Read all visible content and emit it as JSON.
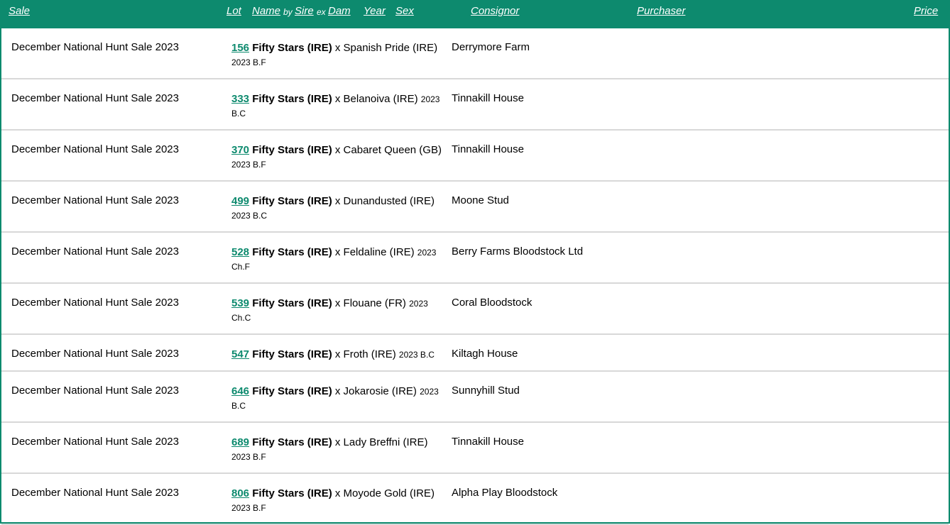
{
  "header": {
    "sale": "Sale",
    "lot": "Lot",
    "name": "Name",
    "by": "by",
    "sire": "Sire",
    "ex": "ex",
    "dam": "Dam",
    "year": "Year",
    "sex": "Sex",
    "consignor": "Consignor",
    "purchaser": "Purchaser",
    "price": "Price"
  },
  "colors": {
    "accent": "#0d8a6e",
    "divider": "#d8d8d8"
  },
  "rows": [
    {
      "sale": "December National Hunt Sale 2023",
      "lot": "156",
      "sire": "Fifty Stars (IRE)",
      "dam": " x Spanish Pride (IRE)",
      "meta": "2023 B.F",
      "consignor": "Derrymore Farm",
      "purchaser": "",
      "price": ""
    },
    {
      "sale": "December National Hunt Sale 2023",
      "lot": "333",
      "sire": "Fifty Stars (IRE)",
      "dam": " x Belanoiva (IRE)",
      "meta": "2023 B.C",
      "consignor": "Tinnakill House",
      "purchaser": "",
      "price": ""
    },
    {
      "sale": "December National Hunt Sale 2023",
      "lot": "370",
      "sire": "Fifty Stars (IRE)",
      "dam": " x Cabaret Queen (GB)",
      "meta": "2023 B.F",
      "consignor": "Tinnakill House",
      "purchaser": "",
      "price": ""
    },
    {
      "sale": "December National Hunt Sale 2023",
      "lot": "499",
      "sire": "Fifty Stars (IRE)",
      "dam": " x Dunandusted (IRE)",
      "meta": "2023 B.C",
      "consignor": "Moone Stud",
      "purchaser": "",
      "price": ""
    },
    {
      "sale": "December National Hunt Sale 2023",
      "lot": "528",
      "sire": "Fifty Stars (IRE)",
      "dam": " x Feldaline (IRE)",
      "meta": "2023 Ch.F",
      "consignor": "Berry Farms Bloodstock Ltd",
      "purchaser": "",
      "price": ""
    },
    {
      "sale": "December National Hunt Sale 2023",
      "lot": "539",
      "sire": "Fifty Stars (IRE)",
      "dam": " x Flouane (FR)",
      "meta": "2023 Ch.C",
      "consignor": "Coral Bloodstock",
      "purchaser": "",
      "price": ""
    },
    {
      "sale": "December National Hunt Sale 2023",
      "lot": "547",
      "sire": "Fifty Stars (IRE)",
      "dam": " x Froth (IRE)",
      "meta": "2023 B.C",
      "consignor": "Kiltagh House",
      "purchaser": "",
      "price": ""
    },
    {
      "sale": "December National Hunt Sale 2023",
      "lot": "646",
      "sire": "Fifty Stars (IRE)",
      "dam": " x Jokarosie (IRE)",
      "meta": "2023 B.C",
      "consignor": "Sunnyhill Stud",
      "purchaser": "",
      "price": ""
    },
    {
      "sale": "December National Hunt Sale 2023",
      "lot": "689",
      "sire": "Fifty Stars (IRE)",
      "dam": " x Lady Breffni (IRE)",
      "meta": "2023 B.F",
      "consignor": "Tinnakill House",
      "purchaser": "",
      "price": ""
    },
    {
      "sale": "December National Hunt Sale 2023",
      "lot": "806",
      "sire": "Fifty Stars (IRE)",
      "dam": " x Moyode Gold (IRE)",
      "meta": "2023 B.F",
      "consignor": "Alpha Play Bloodstock",
      "purchaser": "",
      "price": ""
    }
  ]
}
